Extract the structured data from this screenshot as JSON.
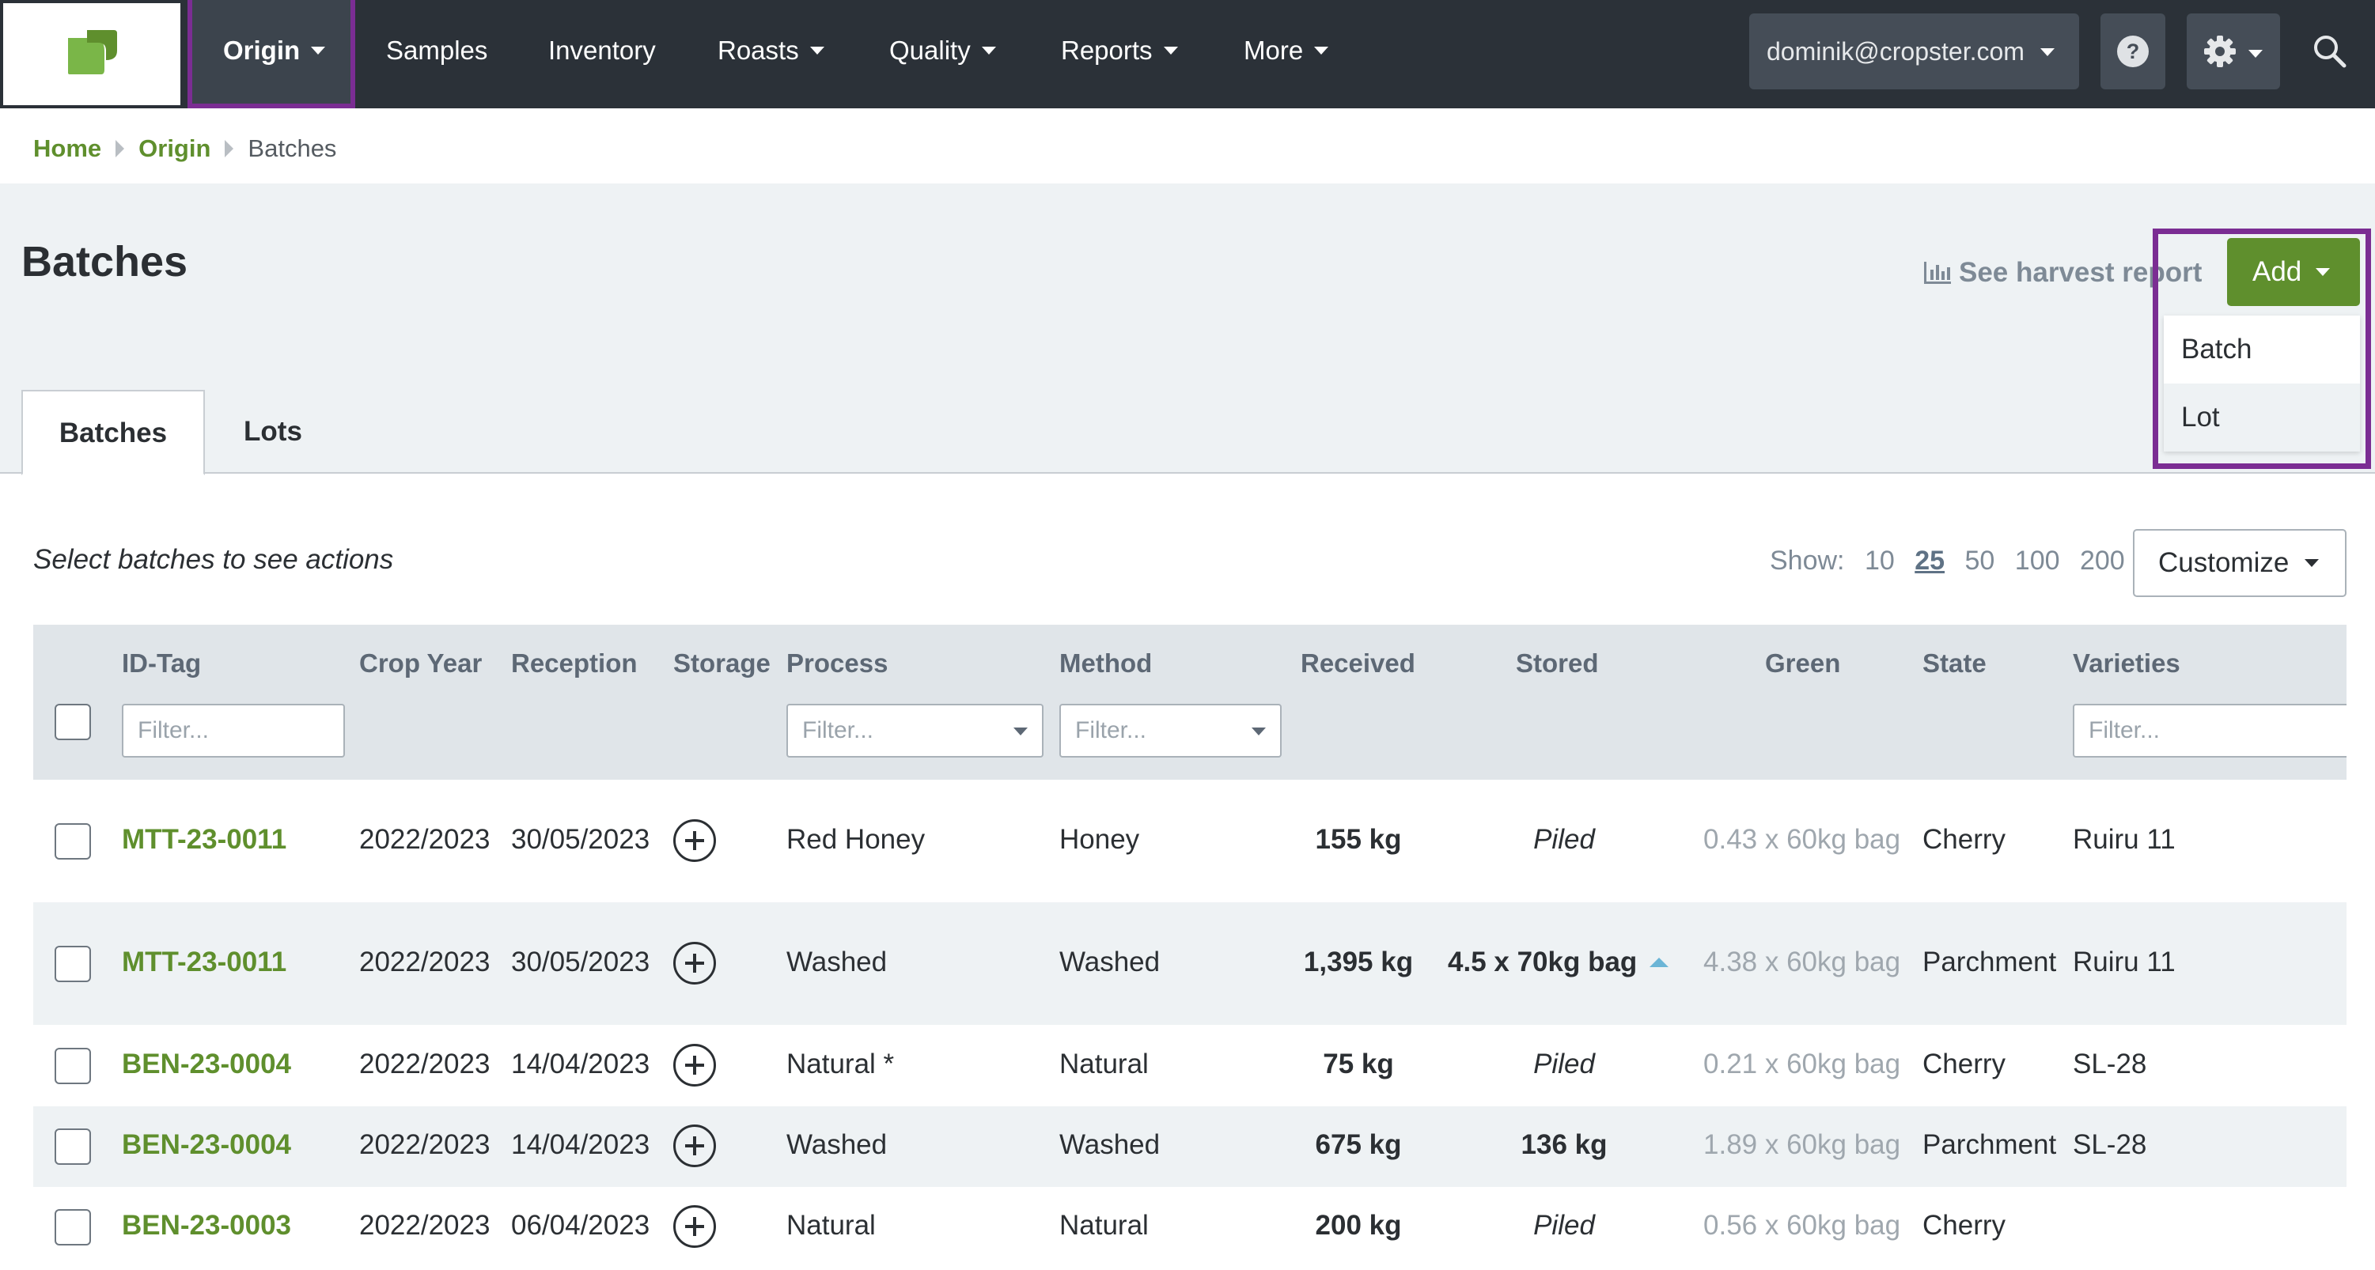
{
  "nav": {
    "items": [
      {
        "label": "Origin",
        "dropdown": true,
        "active": true
      },
      {
        "label": "Samples",
        "dropdown": false
      },
      {
        "label": "Inventory",
        "dropdown": false
      },
      {
        "label": "Roasts",
        "dropdown": true
      },
      {
        "label": "Quality",
        "dropdown": true
      },
      {
        "label": "Reports",
        "dropdown": true
      },
      {
        "label": "More",
        "dropdown": true
      }
    ],
    "user_email": "dominik@cropster.com",
    "help_label": "?",
    "logo_icon": "cropster-leaf-logo",
    "settings_icon": "gear-icon",
    "search_icon": "search-icon"
  },
  "breadcrumb": {
    "items": [
      "Home",
      "Origin",
      "Batches"
    ]
  },
  "page": {
    "title": "Batches",
    "harvest_link": "See harvest report",
    "add_button": "Add",
    "add_menu": [
      "Batch",
      "Lot"
    ]
  },
  "tabs": [
    "Batches",
    "Lots"
  ],
  "table_controls": {
    "hint": "Select batches to see actions",
    "show_label": "Show:",
    "page_sizes": [
      "10",
      "25",
      "50",
      "100",
      "200"
    ],
    "selected_page_size": "25",
    "customize": "Customize"
  },
  "table": {
    "columns": [
      "ID-Tag",
      "Crop Year",
      "Reception",
      "Storage",
      "Process",
      "Method",
      "Received",
      "Stored",
      "Green",
      "State",
      "Varieties"
    ],
    "filter_placeholder": "Filter...",
    "rows": [
      {
        "id": "MTT-23-0011",
        "crop_year": "2022/2023",
        "reception": "30/05/2023",
        "process": "Red Honey",
        "method": "Honey",
        "received": "155 kg",
        "stored": "Piled",
        "green": "0.43 x 60kg bag",
        "state": "Cherry",
        "varieties": "Ruiru 11"
      },
      {
        "id": "MTT-23-0011",
        "crop_year": "2022/2023",
        "reception": "30/05/2023",
        "process": "Washed",
        "method": "Washed",
        "received": "1,395 kg",
        "stored": "4.5 x 70kg bag",
        "green": "4.38 x 60kg bag",
        "state": "Parchment",
        "varieties": "Ruiru 11"
      },
      {
        "id": "BEN-23-0004",
        "crop_year": "2022/2023",
        "reception": "14/04/2023",
        "process": "Natural *",
        "method": "Natural",
        "received": "75 kg",
        "stored": "Piled",
        "green": "0.21 x 60kg bag",
        "state": "Cherry",
        "varieties": "SL-28"
      },
      {
        "id": "BEN-23-0004",
        "crop_year": "2022/2023",
        "reception": "14/04/2023",
        "process": "Washed",
        "method": "Washed",
        "received": "675 kg",
        "stored": "136 kg",
        "green": "1.89 x 60kg bag",
        "state": "Parchment",
        "varieties": "SL-28"
      },
      {
        "id": "BEN-23-0003",
        "crop_year": "2022/2023",
        "reception": "06/04/2023",
        "process": "Natural",
        "method": "Natural",
        "received": "200 kg",
        "stored": "Piled",
        "green": "0.56 x 60kg bag",
        "state": "Cherry",
        "varieties": ""
      }
    ]
  },
  "colors": {
    "nav_bg": "#2b3138",
    "brand_green": "#5f8f2d",
    "highlight_purple": "#7b2d93",
    "stripe_bg": "#eef2f4"
  }
}
